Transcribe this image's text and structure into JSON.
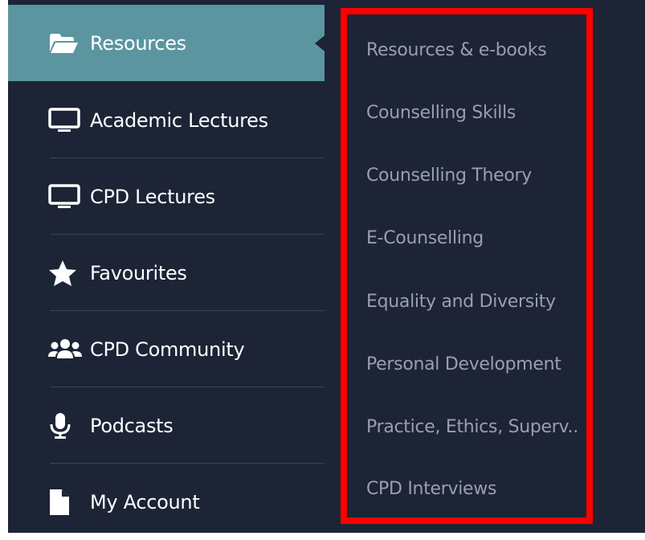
{
  "sidebar": {
    "items": [
      {
        "label": "Resources",
        "icon": "folder-open-icon",
        "active": true
      },
      {
        "label": "Academic Lectures",
        "icon": "monitor-icon"
      },
      {
        "label": "CPD Lectures",
        "icon": "monitor-icon"
      },
      {
        "label": "Favourites",
        "icon": "star-icon"
      },
      {
        "label": "CPD Community",
        "icon": "users-icon"
      },
      {
        "label": "Podcasts",
        "icon": "microphone-icon"
      },
      {
        "label": "My Account",
        "icon": "file-icon"
      }
    ]
  },
  "submenu": {
    "items": [
      "Resources & e-books",
      "Counselling Skills",
      "Counselling Theory",
      "E-Counselling",
      "Equality and Diversity",
      "Personal Development",
      "Practice, Ethics, Superv..",
      "CPD Interviews"
    ]
  },
  "colors": {
    "sidebar_bg": "#1c2436",
    "active_bg": "#5b96a0",
    "submenu_text": "#9aa0aa",
    "highlight": "#ff0000"
  }
}
